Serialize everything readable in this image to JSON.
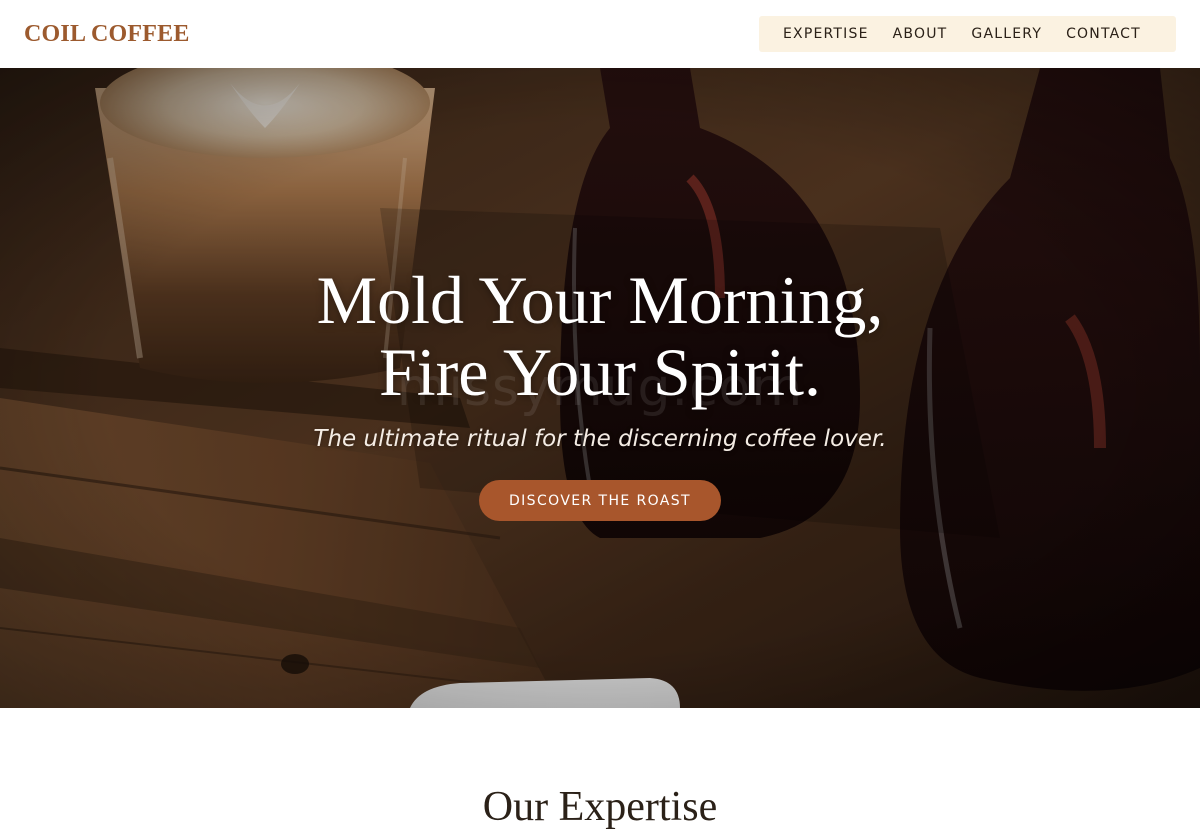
{
  "brand": {
    "name": "COIL COFFEE",
    "color": "#9c5a2e"
  },
  "nav": {
    "items": [
      {
        "label": "EXPERTISE"
      },
      {
        "label": "ABOUT"
      },
      {
        "label": "GALLERY"
      },
      {
        "label": "CONTACT"
      }
    ],
    "background": "#fbf2e1"
  },
  "hero": {
    "title_line1": "Mold Your Morning,",
    "title_line2": "Fire Your Spirit.",
    "subtitle": "The ultimate ritual for the discerning coffee lover.",
    "cta_label": "DISCOVER THE ROAST",
    "cta_color": "#a8562c",
    "watermark": "missymug.com"
  },
  "section": {
    "heading": "Our Expertise"
  }
}
